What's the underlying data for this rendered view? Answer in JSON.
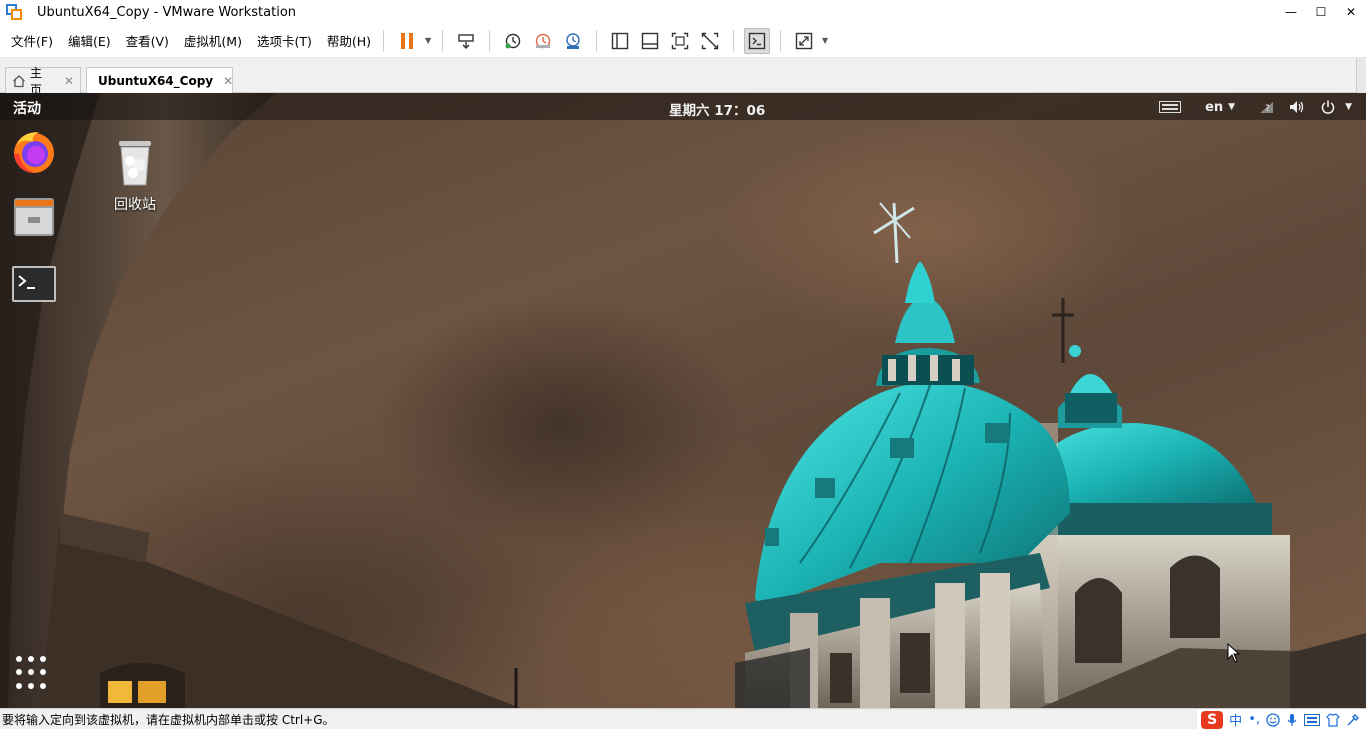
{
  "window": {
    "title": "UbuntuX64_Copy - VMware Workstation",
    "minimize": "—",
    "maximize": "☐",
    "close": "✕"
  },
  "menu": {
    "items": [
      "文件(F)",
      "编辑(E)",
      "查看(V)",
      "虚拟机(M)",
      "选项卡(T)",
      "帮助(H)"
    ]
  },
  "toolbar": {
    "icons": [
      "pause-icon",
      "send-ctrl-alt-del-icon",
      "snapshot-take-icon",
      "snapshot-revert-icon",
      "snapshot-manager-icon",
      "library-view-icon",
      "console-view-icon",
      "fullscreen-icon",
      "unity-icon",
      "terminal-icon",
      "stretch-icon"
    ],
    "accent_pause": "#e8741a"
  },
  "tabs": [
    {
      "label": "主页",
      "icon": "home-icon"
    },
    {
      "label": "UbuntuX64_Copy",
      "icon": "vm-icon",
      "active": true
    }
  ],
  "guest": {
    "activities": "活动",
    "clock": "星期六 17：06",
    "lang": "en",
    "tray_icons": [
      "keyboard-icon",
      "network-question-icon",
      "volume-icon",
      "power-icon"
    ],
    "desktop": {
      "trash_label": "回收站"
    },
    "dock": [
      "firefox-icon",
      "files-icon",
      "terminal-icon",
      "show-apps-icon"
    ]
  },
  "statusbar": {
    "text": "要将输入定向到该虚拟机，请在虚拟机内部单击或按 Ctrl+G。",
    "ime_logo": "S",
    "ime_lang": "中",
    "ime_punct": "•,"
  }
}
